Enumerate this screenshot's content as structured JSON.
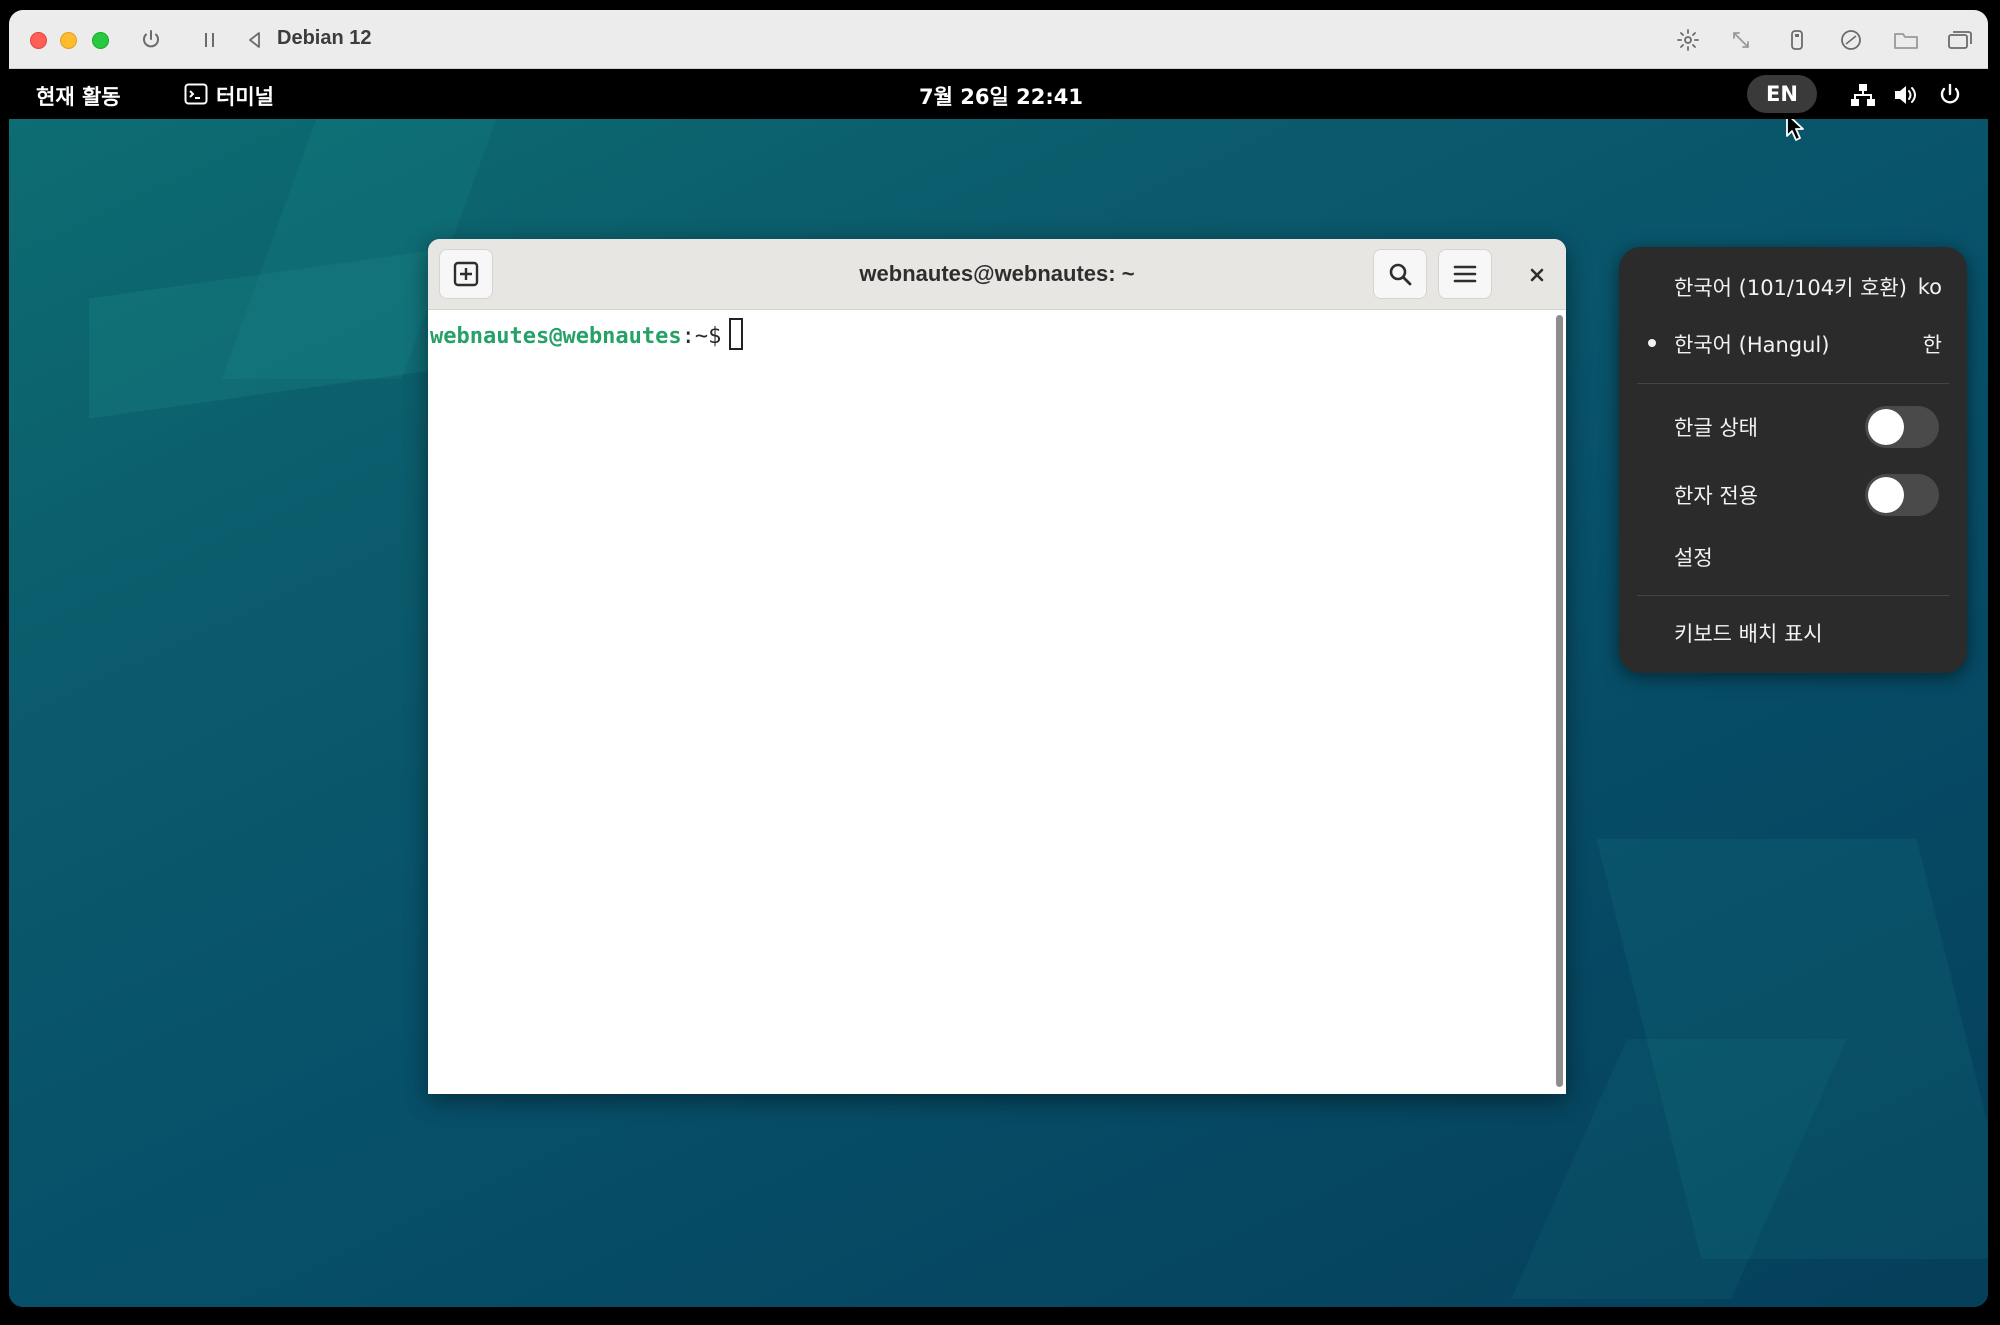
{
  "vm": {
    "title": "Debian 12"
  },
  "topbar": {
    "activities": "현재 활동",
    "app_name": "터미널",
    "clock": "7월 26일  22:41",
    "input_indicator": "EN"
  },
  "terminal": {
    "title": "webnautes@webnautes: ~",
    "prompt_user": "webnautes@webnautes",
    "prompt_rest": ":~$"
  },
  "ime_menu": {
    "items": [
      {
        "label": "한국어 (101/104키 호환)",
        "code": "ko",
        "selected": false
      },
      {
        "label": "한국어 (Hangul)",
        "code": "한",
        "selected": true
      }
    ],
    "toggles": [
      {
        "label": "한글 상태",
        "on": false
      },
      {
        "label": "한자 전용",
        "on": false
      }
    ],
    "settings": "설정",
    "show_layout": "키보드 배치 표시"
  },
  "colors": {
    "prompt_green": "#26a269",
    "desktop": "#0a4a5e"
  }
}
